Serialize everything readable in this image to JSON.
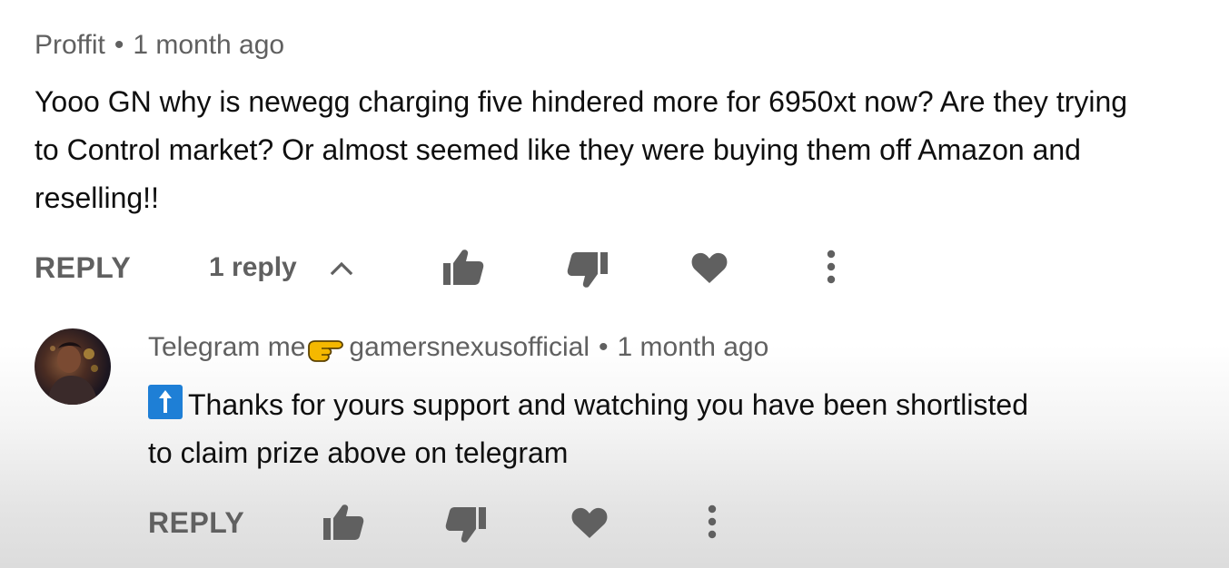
{
  "comment": {
    "author": "Proffit",
    "separator": "•",
    "time": "1 month ago",
    "text_lines": [
      "Yooo GN why is newegg charging five hindered more for 6950xt now?  Are they trying",
      "to Control market?  Or almost seemed like they were buying them off Amazon and",
      "reselling!!"
    ],
    "actions": {
      "reply_label": "REPLY",
      "replies_label": "1 reply"
    }
  },
  "reply": {
    "author_prefix": "Telegram me",
    "author_suffix": "gamersnexusofficial",
    "separator": "•",
    "time": "1 month ago",
    "text_line1": "Thanks for yours support and watching you have been shortlisted",
    "text_line2": "to claim prize above on telegram",
    "actions": {
      "reply_label": "REPLY"
    }
  },
  "icons": {
    "expand": "chevron-up-icon",
    "like": "thumbs-up-icon",
    "dislike": "thumbs-down-icon",
    "heart": "heart-icon",
    "more": "more-vert-icon",
    "pointing": "pointing-hand-icon",
    "up_arrow": "up-arrow-icon"
  },
  "colors": {
    "text": "#0f0f0f",
    "secondary": "#606060",
    "icon": "#606060",
    "emoji_blue": "#1e7fd6",
    "emoji_yellow": "#f5b800"
  }
}
